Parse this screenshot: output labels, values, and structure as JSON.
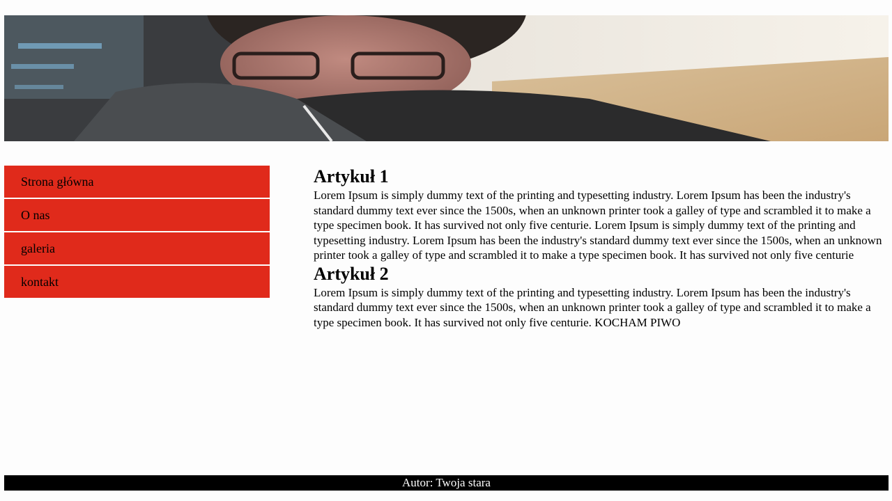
{
  "banner": {
    "image_description": "banner-selfie-photo"
  },
  "menu": {
    "items": [
      {
        "label": "Strona główna"
      },
      {
        "label": "O nas"
      },
      {
        "label": "galeria"
      },
      {
        "label": "kontakt"
      }
    ]
  },
  "articles": [
    {
      "title": "Artykuł 1",
      "body": "Lorem Ipsum is simply dummy text of the printing and typesetting industry. Lorem Ipsum has been the industry's standard dummy text ever since the 1500s, when an unknown printer took a galley of type and scrambled it to make a type specimen book. It has survived not only five centurie. Lorem Ipsum is simply dummy text of the printing and typesetting industry. Lorem Ipsum has been the industry's standard dummy text ever since the 1500s, when an unknown printer took a galley of type and scrambled it to make a type specimen book. It has survived not only five centurie"
    },
    {
      "title": "Artykuł 2",
      "body": "Lorem Ipsum is simply dummy text of the printing and typesetting industry. Lorem Ipsum has been the industry's standard dummy text ever since the 1500s, when an unknown printer took a galley of type and scrambled it to make a type specimen book. It has survived not only five centurie. KOCHAM PIWO"
    }
  ],
  "footer": {
    "text": "Autor: Twoja stara"
  },
  "colors": {
    "menu_bg": "#e02a1b",
    "footer_bg": "#000000",
    "footer_text": "#ffffff"
  }
}
